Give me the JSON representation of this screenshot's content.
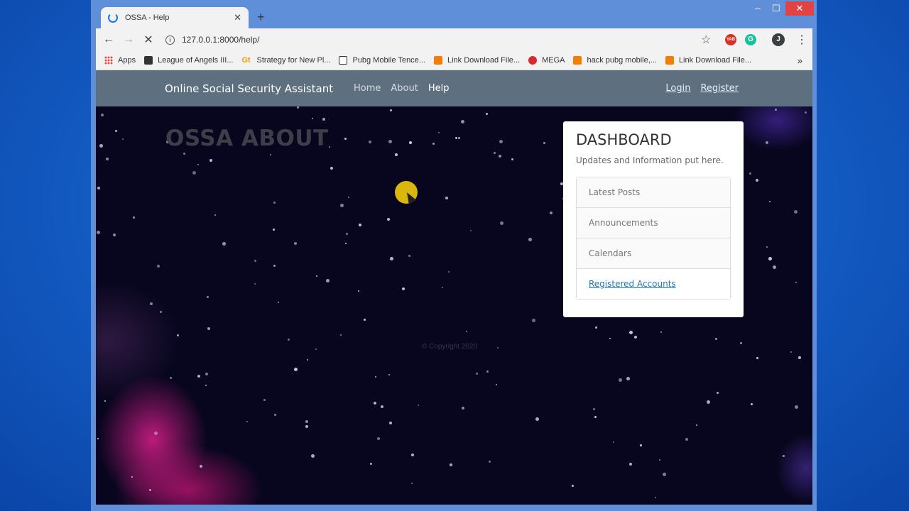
{
  "browser": {
    "tab_title": "OSSA - Help",
    "new_tab": "+",
    "url": "127.0.0.1:8000/help/",
    "window_controls": {
      "minimize": "–",
      "maximize": "☐",
      "close": "✕"
    },
    "profile_initial": "J",
    "ext_red_label": "YAB",
    "ext_green_label": "G",
    "bookmarks": [
      {
        "label": "Apps",
        "icon": "apps-grid-icon"
      },
      {
        "label": "League of Angels III...",
        "icon": "league-icon"
      },
      {
        "label": "Strategy for New Pl...",
        "icon": "gt-icon"
      },
      {
        "label": "Pubg Mobile Tence...",
        "icon": "m-icon"
      },
      {
        "label": "Link Download File...",
        "icon": "blogger-icon"
      },
      {
        "label": "MEGA",
        "icon": "mega-icon"
      },
      {
        "label": "hack pubg mobile,...",
        "icon": "blogger-icon"
      },
      {
        "label": "Link Download File...",
        "icon": "blogger-icon"
      }
    ],
    "bookmarks_more": "»"
  },
  "navbar": {
    "brand": "Online Social Security Assistant",
    "links": [
      "Home",
      "About",
      "Help"
    ],
    "login": "Login",
    "register": "Register"
  },
  "main": {
    "heading": "OSSA ABOUT",
    "copyright": "© Copyright 2020"
  },
  "dashboard": {
    "title": "DASHBOARD",
    "subtitle": "Updates and Information put here.",
    "items": [
      "Latest Posts",
      "Announcements",
      "Calendars",
      "Registered Accounts"
    ]
  }
}
